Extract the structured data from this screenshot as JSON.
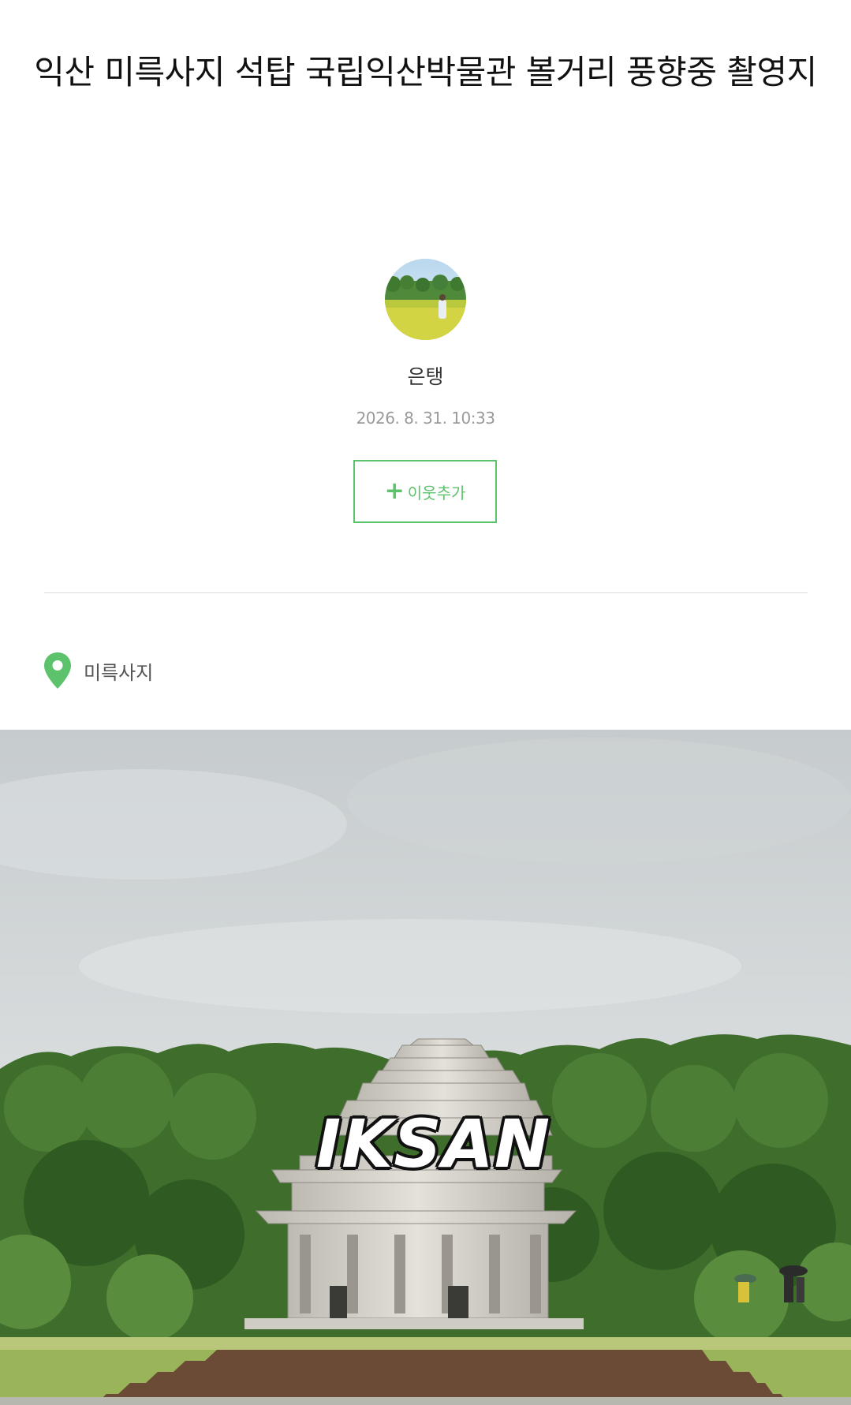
{
  "post": {
    "title": "익산 미륵사지 석탑 국립익산박물관 볼거리 풍향중 촬영지",
    "author": "은탱",
    "date": "2026. 8. 31. 10:33",
    "follow_plus": "+",
    "follow_label": "이웃추가",
    "location": "미륵사지",
    "photo_caption": "IKSAN"
  },
  "colors": {
    "accent": "#5cc26b",
    "divider": "#dcdcdc"
  },
  "icons": {
    "avatar": "profile-photo",
    "location": "map-pin-icon"
  }
}
